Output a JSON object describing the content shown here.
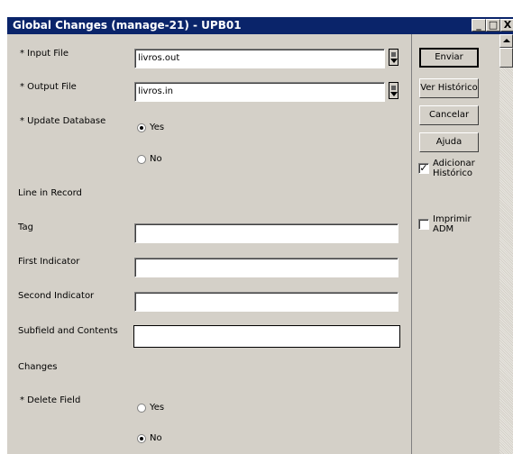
{
  "window": {
    "title": "Global Changes (manage-21) - UPB01",
    "minimize_glyph": "_",
    "maximize_glyph": "□",
    "close_glyph": "X"
  },
  "form": {
    "input_file_label": "* Input File",
    "input_file_value": "livros.out",
    "output_file_label": "* Output File",
    "output_file_value": "livros.in",
    "update_db_label": "* Update Database",
    "update_db_yes": "Yes",
    "update_db_no": "No",
    "line_in_record_label": "Line in Record",
    "tag_label": "Tag",
    "tag_value": "",
    "first_indicator_label": "First Indicator",
    "first_indicator_value": "",
    "second_indicator_label": "Second Indicator",
    "second_indicator_value": "",
    "subfield_label": "Subfield and Contents",
    "subfield_value": "",
    "changes_label": "Changes",
    "delete_field_label": "* Delete Field",
    "delete_yes": "Yes",
    "delete_no": "No"
  },
  "panel": {
    "enviar": "Enviar",
    "ver_historico": "Ver Histórico",
    "cancelar": "Cancelar",
    "ajuda": "Ajuda",
    "adicionar_line1": "Adicionar",
    "adicionar_line2": "Histórico",
    "imprimir_line1": "Imprimir",
    "imprimir_line2": "ADM",
    "adicionar_checked": true,
    "imprimir_checked": false
  },
  "icons": {
    "file_picker": "file-picker-icon",
    "scroll_up": "scroll-up-arrow-icon",
    "check_mark": "✓"
  }
}
